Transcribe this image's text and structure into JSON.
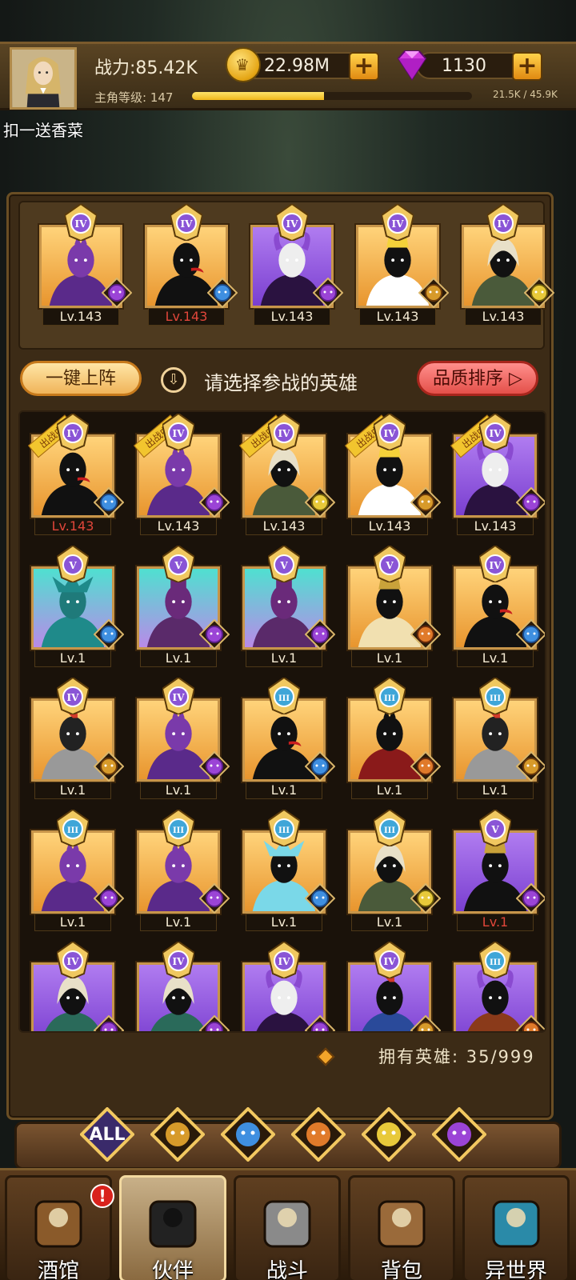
{
  "header": {
    "power_label": "战力:85.42K",
    "gold_value": "22.98M",
    "gem_value": "1130",
    "plus_symbol": "+",
    "level_label": "主角等级: 147",
    "xp_text": "21.5K / 45.9K",
    "xp_fraction": 0.47
  },
  "chat_message": "扣一送香菜",
  "team": [
    {
      "rank": "IV",
      "level": "Lv.143",
      "level_red": false,
      "portrait": "purple-orc",
      "bg": "gold",
      "faction": "orc-icon"
    },
    {
      "rank": "IV",
      "level": "Lv.143",
      "level_red": true,
      "portrait": "goblin",
      "bg": "gold",
      "faction": "elf-icon"
    },
    {
      "rank": "IV",
      "level": "Lv.143",
      "level_red": false,
      "portrait": "skull-demon",
      "bg": "purple",
      "faction": "orc-icon"
    },
    {
      "rank": "IV",
      "level": "Lv.143",
      "level_red": false,
      "portrait": "priest",
      "bg": "gold",
      "faction": "human-icon"
    },
    {
      "rank": "IV",
      "level": "Lv.143",
      "level_red": false,
      "portrait": "elf-ranger",
      "bg": "gold",
      "faction": "fairy-icon"
    }
  ],
  "controls": {
    "auto_deploy": "一键上阵",
    "prompt": "请选择参战的英雄",
    "sort": "品质排序"
  },
  "deployed_ribbon": "出战中",
  "heroes": [
    {
      "rank": "IV",
      "level": "Lv.143",
      "level_red": true,
      "portrait": "goblin",
      "bg": "gold",
      "faction": "elf-icon",
      "deployed": true
    },
    {
      "rank": "IV",
      "level": "Lv.143",
      "level_red": false,
      "portrait": "purple-orc",
      "bg": "gold",
      "faction": "orc-icon",
      "deployed": true
    },
    {
      "rank": "IV",
      "level": "Lv.143",
      "level_red": false,
      "portrait": "elf-ranger",
      "bg": "gold",
      "faction": "fairy-icon",
      "deployed": true
    },
    {
      "rank": "IV",
      "level": "Lv.143",
      "level_red": false,
      "portrait": "priest",
      "bg": "gold",
      "faction": "human-icon",
      "deployed": true
    },
    {
      "rank": "IV",
      "level": "Lv.143",
      "level_red": false,
      "portrait": "skull-demon",
      "bg": "purple",
      "faction": "orc-icon",
      "deployed": true
    },
    {
      "rank": "V",
      "level": "Lv.1",
      "level_red": false,
      "portrait": "fish-knight",
      "bg": "teal",
      "faction": "elf-icon",
      "deployed": false
    },
    {
      "rank": "V",
      "level": "Lv.1",
      "level_red": false,
      "portrait": "purple-ogre",
      "bg": "teal",
      "faction": "orc-icon",
      "deployed": false
    },
    {
      "rank": "V",
      "level": "Lv.1",
      "level_red": false,
      "portrait": "purple-ogre",
      "bg": "teal",
      "faction": "orc-icon",
      "deployed": false
    },
    {
      "rank": "V",
      "level": "Lv.1",
      "level_red": false,
      "portrait": "pharaoh",
      "bg": "gold",
      "faction": "beast-icon",
      "deployed": false
    },
    {
      "rank": "IV",
      "level": "Lv.1",
      "level_red": false,
      "portrait": "goblin",
      "bg": "gold",
      "faction": "elf-icon",
      "deployed": false
    },
    {
      "rank": "IV",
      "level": "Lv.1",
      "level_red": false,
      "portrait": "red-knight",
      "bg": "gold",
      "faction": "human-icon",
      "deployed": false
    },
    {
      "rank": "IV",
      "level": "Lv.1",
      "level_red": false,
      "portrait": "purple-orc",
      "bg": "gold",
      "faction": "orc-icon",
      "deployed": false
    },
    {
      "rank": "III",
      "level": "Lv.1",
      "level_red": false,
      "portrait": "goblin",
      "bg": "gold",
      "faction": "elf-icon",
      "deployed": false
    },
    {
      "rank": "III",
      "level": "Lv.1",
      "level_red": false,
      "portrait": "red-warrior",
      "bg": "gold",
      "faction": "beast-icon",
      "deployed": false
    },
    {
      "rank": "III",
      "level": "Lv.1",
      "level_red": false,
      "portrait": "red-knight",
      "bg": "gold",
      "faction": "human-icon",
      "deployed": false
    },
    {
      "rank": "III",
      "level": "Lv.1",
      "level_red": false,
      "portrait": "purple-orc",
      "bg": "gold",
      "faction": "orc-icon",
      "deployed": false
    },
    {
      "rank": "III",
      "level": "Lv.1",
      "level_red": false,
      "portrait": "purple-orc",
      "bg": "gold",
      "faction": "orc-icon",
      "deployed": false
    },
    {
      "rank": "III",
      "level": "Lv.1",
      "level_red": false,
      "portrait": "cyan-spirit",
      "bg": "gold",
      "faction": "elf-icon",
      "deployed": false
    },
    {
      "rank": "III",
      "level": "Lv.1",
      "level_red": false,
      "portrait": "elf-ranger",
      "bg": "gold",
      "faction": "fairy-icon",
      "deployed": false
    },
    {
      "rank": "V",
      "level": "Lv.1",
      "level_red": true,
      "portrait": "dark-king",
      "bg": "purple",
      "faction": "orc-icon",
      "deployed": false
    },
    {
      "rank": "IV",
      "level": "",
      "level_red": false,
      "portrait": "bearded-sage",
      "bg": "purple",
      "faction": "orc-icon",
      "deployed": false
    },
    {
      "rank": "IV",
      "level": "",
      "level_red": false,
      "portrait": "bearded-sage",
      "bg": "purple",
      "faction": "orc-icon",
      "deployed": false
    },
    {
      "rank": "IV",
      "level": "",
      "level_red": false,
      "portrait": "skull-demon",
      "bg": "purple",
      "faction": "orc-icon",
      "deployed": false
    },
    {
      "rank": "IV",
      "level": "",
      "level_red": false,
      "portrait": "feather-mage",
      "bg": "purple",
      "faction": "human-icon",
      "deployed": false
    },
    {
      "rank": "III",
      "level": "",
      "level_red": false,
      "portrait": "fox-rogue",
      "bg": "purple",
      "faction": "beast-icon",
      "deployed": false
    }
  ],
  "owned_heroes": "拥有英雄: 35/999",
  "filters": [
    {
      "label": "ALL",
      "icon": "all-filter"
    },
    {
      "label": "",
      "icon": "human-icon"
    },
    {
      "label": "",
      "icon": "elf-icon"
    },
    {
      "label": "",
      "icon": "beast-icon"
    },
    {
      "label": "",
      "icon": "fairy-icon"
    },
    {
      "label": "",
      "icon": "orc-icon"
    }
  ],
  "nav": [
    {
      "label": "酒馆",
      "icon": "tavern-icon",
      "alert": "!"
    },
    {
      "label": "伙伴",
      "icon": "partner-icon",
      "alert": ""
    },
    {
      "label": "战斗",
      "icon": "battle-icon",
      "alert": ""
    },
    {
      "label": "背包",
      "icon": "backpack-icon",
      "alert": ""
    },
    {
      "label": "异世界",
      "icon": "portal-icon",
      "alert": ""
    }
  ],
  "colors": {
    "gold_bg": "#f2b54a",
    "purple_bg": "#9b5ee0",
    "teal_bg": "#48c8c0",
    "rank_IV": "#8a55d6",
    "rank_V": "#8a55d6",
    "rank_III": "#3fa6d8"
  }
}
